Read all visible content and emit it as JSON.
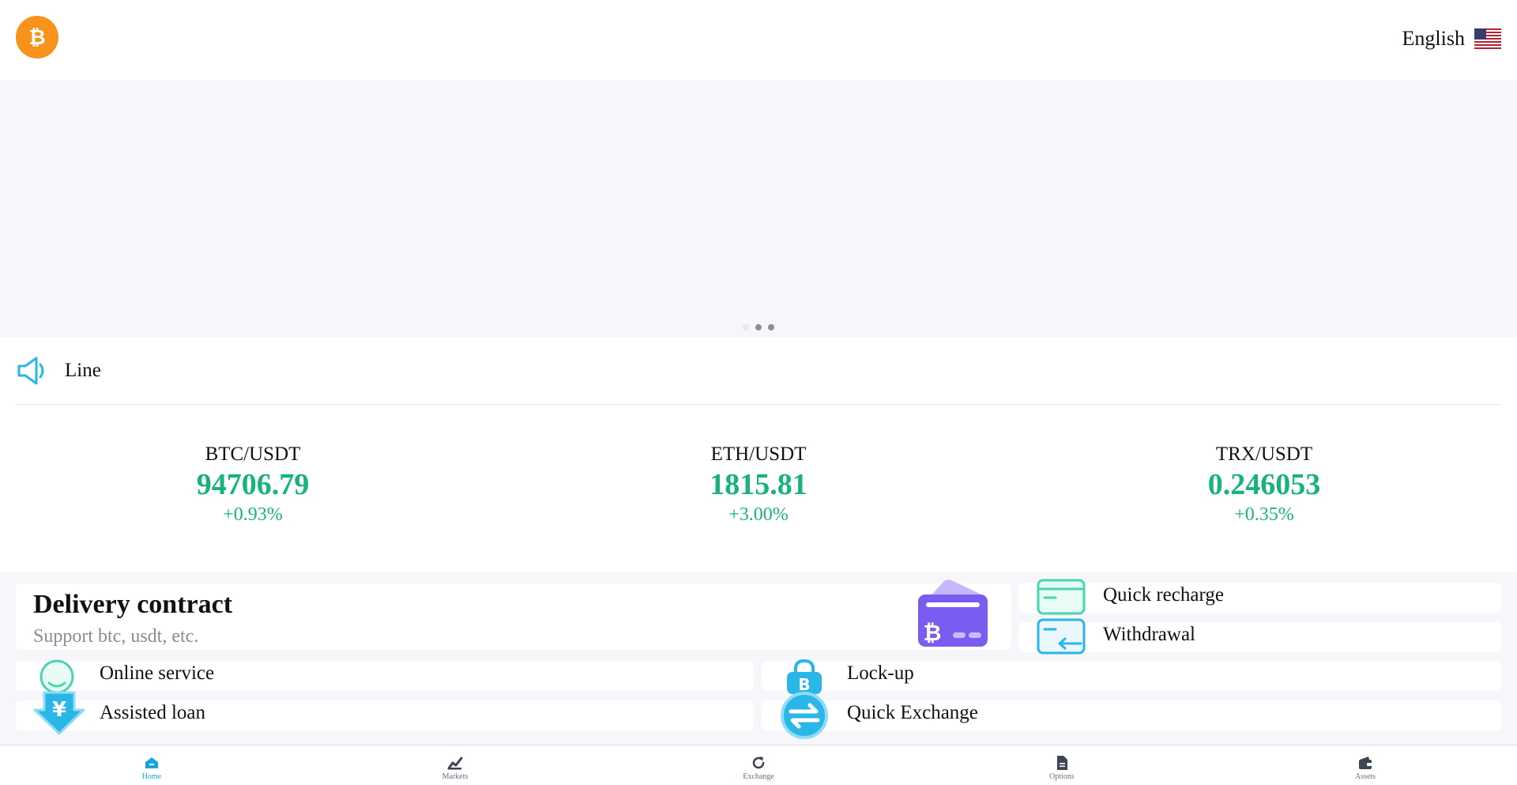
{
  "header": {
    "logo_icon": "bitcoin-logo-icon",
    "language_label": "English",
    "flag_icon": "us-flag-icon"
  },
  "banner": {
    "dots": 3,
    "active_dot": 0
  },
  "notice": {
    "icon": "speaker-icon",
    "text": "Line"
  },
  "tickers": [
    {
      "pair": "BTC/USDT",
      "price": "94706.79",
      "change": "+0.93%"
    },
    {
      "pair": "ETH/USDT",
      "price": "1815.81",
      "change": "+3.00%"
    },
    {
      "pair": "TRX/USDT",
      "price": "0.246053",
      "change": "+0.35%"
    }
  ],
  "features": {
    "delivery": {
      "title": "Delivery contract",
      "subtitle": "Support btc, usdt, etc."
    },
    "quick_recharge": "Quick recharge",
    "withdrawal": "Withdrawal",
    "online_service": "Online service",
    "assisted_loan": "Assisted loan",
    "lock_up": "Lock-up",
    "quick_exchange": "Quick Exchange"
  },
  "nav": [
    {
      "label": "Home",
      "icon": "home-icon",
      "active": true
    },
    {
      "label": "Markets",
      "icon": "chart-icon",
      "active": false
    },
    {
      "label": "Exchange",
      "icon": "refresh-icon",
      "active": false
    },
    {
      "label": "Options",
      "icon": "document-icon",
      "active": false
    },
    {
      "label": "Assets",
      "icon": "wallet-icon",
      "active": false
    }
  ],
  "colors": {
    "accent": "#1aa3df",
    "up": "#17b37f",
    "brand_orange": "#f7931a",
    "purple": "#7b5cf0",
    "teal": "#46d6b0"
  }
}
